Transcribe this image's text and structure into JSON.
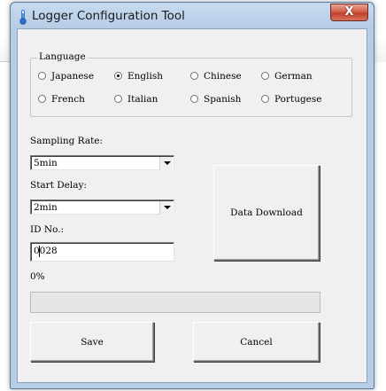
{
  "window": {
    "title": "Logger Configuration Tool",
    "close_label": "X"
  },
  "language": {
    "legend": "Language",
    "options": [
      {
        "label": "Japanese",
        "checked": false
      },
      {
        "label": "English",
        "checked": true
      },
      {
        "label": "Chinese",
        "checked": false
      },
      {
        "label": "German",
        "checked": false
      },
      {
        "label": "French",
        "checked": false
      },
      {
        "label": "Italian",
        "checked": false
      },
      {
        "label": "Spanish",
        "checked": false
      },
      {
        "label": "Portugese",
        "checked": false
      }
    ]
  },
  "sampling_rate": {
    "label": "Sampling Rate:",
    "value": "5min"
  },
  "start_delay": {
    "label": "Start Delay:",
    "value": "2min"
  },
  "id_no": {
    "label": "ID No.:",
    "value": "0028"
  },
  "data_download": {
    "label": "Data Download"
  },
  "progress": {
    "label": "0%",
    "value": 0
  },
  "buttons": {
    "save": "Save",
    "cancel": "Cancel"
  },
  "colors": {
    "window_frame": "#b7cde6",
    "client_bg": "#f0f0f0",
    "close_button": "#c0402a",
    "progress_fill": "#06b025"
  }
}
